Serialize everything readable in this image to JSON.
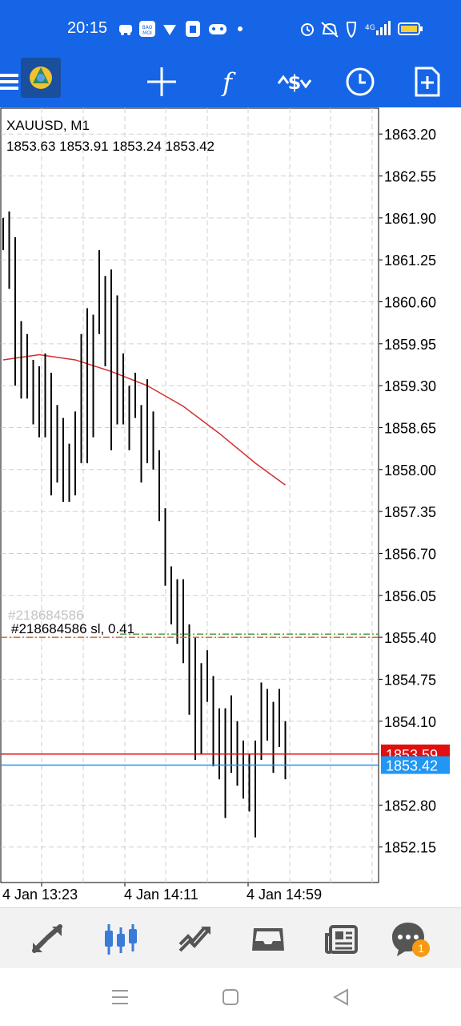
{
  "status_bar": {
    "time": "20:15",
    "lte": "4G",
    "left_icons": [
      "car-icon",
      "baomoi-icon",
      "vpn-icon",
      "app-icon",
      "gamepad-icon",
      "dot-icon"
    ],
    "right_icons": [
      "alarm-icon",
      "mute-icon",
      "shield-icon",
      "signal-icon",
      "battery-icon"
    ]
  },
  "toolbar": {
    "items": [
      "menu-icon",
      "metatrader-logo",
      "crosshair-icon",
      "function-icon",
      "trade-icon",
      "clock-icon",
      "new-order-icon"
    ]
  },
  "chart": {
    "symbol_label": "XAUUSD, M1",
    "ohlc_label": "1853.63 1853.91 1853.24 1853.42",
    "order_label": "#218684586 sl, 0.41",
    "order_label_ghost": "#218684586",
    "price_ticks": [
      "1863.20",
      "1862.55",
      "1861.90",
      "1861.25",
      "1860.60",
      "1859.95",
      "1859.30",
      "1858.65",
      "1858.00",
      "1857.35",
      "1856.70",
      "1856.05",
      "1855.40",
      "1854.75",
      "1854.10",
      "1853.59",
      "1853.42",
      "1852.80",
      "1852.15"
    ],
    "ask_label": "1853.59",
    "bid_label": "1853.42",
    "time_labels": [
      "4 Jan 13:23",
      "4 Jan 14:11",
      "4 Jan 14:59"
    ],
    "colors": {
      "ask": "#e01010",
      "bid": "#2196f3",
      "ma": "#d32f2f",
      "sl_line": "#e0601c",
      "tp_line": "#2e8b2e",
      "bars": "#000000",
      "grid": "#cfcfcf"
    }
  },
  "chart_data": {
    "type": "ohlc",
    "symbol": "XAUUSD",
    "timeframe": "M1",
    "ylim": [
      1851.6,
      1863.6
    ],
    "ask": 1853.59,
    "bid": 1853.42,
    "order_level": 1855.4,
    "ma_points": [
      [
        0,
        1859.7
      ],
      [
        6,
        1859.78
      ],
      [
        12,
        1859.7
      ],
      [
        18,
        1859.52
      ],
      [
        24,
        1859.3
      ],
      [
        30,
        1858.98
      ],
      [
        36,
        1858.56
      ],
      [
        42,
        1858.1
      ],
      [
        47,
        1857.76
      ]
    ],
    "bars": [
      [
        0,
        1861.9,
        1861.4
      ],
      [
        1,
        1862.0,
        1860.8
      ],
      [
        2,
        1861.6,
        1859.3
      ],
      [
        3,
        1860.3,
        1859.1
      ],
      [
        4,
        1860.1,
        1859.1
      ],
      [
        5,
        1859.7,
        1858.7
      ],
      [
        6,
        1859.6,
        1858.5
      ],
      [
        7,
        1859.8,
        1858.5
      ],
      [
        8,
        1859.5,
        1857.6
      ],
      [
        9,
        1859.0,
        1857.8
      ],
      [
        10,
        1858.8,
        1857.5
      ],
      [
        11,
        1858.4,
        1857.5
      ],
      [
        12,
        1858.9,
        1857.6
      ],
      [
        13,
        1860.1,
        1858.1
      ],
      [
        14,
        1860.5,
        1858.1
      ],
      [
        15,
        1860.4,
        1858.5
      ],
      [
        16,
        1861.4,
        1860.1
      ],
      [
        17,
        1861.0,
        1859.6
      ],
      [
        18,
        1861.1,
        1858.3
      ],
      [
        19,
        1860.7,
        1858.7
      ],
      [
        20,
        1859.8,
        1858.7
      ],
      [
        21,
        1859.3,
        1858.3
      ],
      [
        22,
        1859.5,
        1858.8
      ],
      [
        23,
        1859.0,
        1857.8
      ],
      [
        24,
        1859.4,
        1858.1
      ],
      [
        25,
        1858.9,
        1858.0
      ],
      [
        26,
        1858.3,
        1857.2
      ],
      [
        27,
        1857.4,
        1856.2
      ],
      [
        28,
        1856.5,
        1855.6
      ],
      [
        29,
        1856.3,
        1855.3
      ],
      [
        30,
        1856.3,
        1855.0
      ],
      [
        31,
        1855.6,
        1854.2
      ],
      [
        32,
        1855.4,
        1853.5
      ],
      [
        33,
        1855.0,
        1853.6
      ],
      [
        34,
        1855.2,
        1854.4
      ],
      [
        35,
        1854.8,
        1853.4
      ],
      [
        36,
        1854.3,
        1853.2
      ],
      [
        37,
        1854.3,
        1852.6
      ],
      [
        38,
        1854.5,
        1853.3
      ],
      [
        39,
        1854.1,
        1853.1
      ],
      [
        40,
        1853.8,
        1852.9
      ],
      [
        41,
        1853.6,
        1852.7
      ],
      [
        42,
        1853.8,
        1852.3
      ],
      [
        43,
        1854.7,
        1853.5
      ],
      [
        44,
        1854.6,
        1853.8
      ],
      [
        45,
        1854.4,
        1853.3
      ],
      [
        46,
        1854.6,
        1853.7
      ],
      [
        47,
        1854.1,
        1853.2
      ]
    ]
  },
  "bottom_bar": {
    "items": [
      "quotes-icon",
      "chart-icon",
      "trade-icon",
      "history-icon",
      "news-icon",
      "messages-icon"
    ],
    "badge": "1"
  },
  "nav_bar": {
    "items": [
      "recents-button",
      "home-button",
      "back-button"
    ]
  }
}
